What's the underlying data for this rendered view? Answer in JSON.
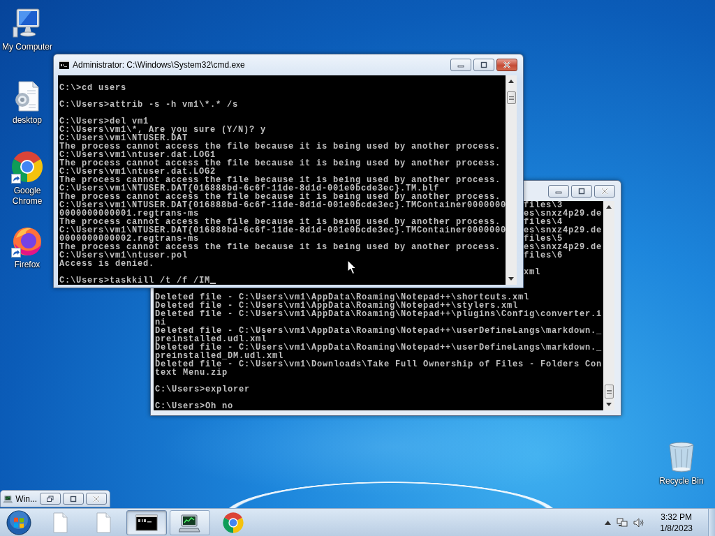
{
  "desktop_icons": [
    {
      "label": "My Computer",
      "kind": "computer",
      "shortcut": false
    },
    {
      "label": "desktop",
      "kind": "settings-file",
      "shortcut": false
    },
    {
      "label": "Google Chrome",
      "kind": "chrome",
      "shortcut": true
    },
    {
      "label": "Firefox",
      "kind": "firefox",
      "shortcut": true
    },
    {
      "label": "Recycle Bin",
      "kind": "recycle-bin",
      "shortcut": false
    }
  ],
  "windows": [
    {
      "active": false,
      "cursor": false,
      "fragment_blocks": [
        [
          "files\\3",
          "es\\snxz4p29.de",
          "files\\4",
          "es\\snxz4p29.de",
          "files\\5",
          "es\\snxz4p29.de",
          "files\\6"
        ],
        [
          "xml"
        ]
      ],
      "blocks": [
        [
          "Deleted file - C:\\Users\\vm1\\AppData\\Roaming\\Notepad++\\shortcuts.xml",
          "Deleted file - C:\\Users\\vm1\\AppData\\Roaming\\Notepad++\\stylers.xml",
          "Deleted file - C:\\Users\\vm1\\AppData\\Roaming\\Notepad++\\plugins\\Config\\converter.i",
          "ni",
          "Deleted file - C:\\Users\\vm1\\AppData\\Roaming\\Notepad++\\userDefineLangs\\markdown._",
          "preinstalled.udl.xml",
          "Deleted file - C:\\Users\\vm1\\AppData\\Roaming\\Notepad++\\userDefineLangs\\markdown._",
          "preinstalled_DM.udl.xml",
          "Deleted file - C:\\Users\\vm1\\Downloads\\Take Full Ownership of Files - Folders Con",
          "text Menu.zip"
        ],
        [
          "C:\\Users>explorer"
        ],
        [
          "C:\\Users>Oh no"
        ]
      ]
    },
    {
      "active": true,
      "cursor": true,
      "title": "Administrator: C:\\Windows\\System32\\cmd.exe",
      "blocks": [
        [
          "C:\\>cd users"
        ],
        [
          "C:\\Users>attrib -s -h vm1\\*.* /s"
        ],
        [
          "C:\\Users>del vm1",
          "C:\\Users\\vm1\\*, Are you sure (Y/N)? y",
          "C:\\Users\\vm1\\NTUSER.DAT",
          "The process cannot access the file because it is being used by another process.",
          "C:\\Users\\vm1\\ntuser.dat.LOG1",
          "The process cannot access the file because it is being used by another process.",
          "C:\\Users\\vm1\\ntuser.dat.LOG2",
          "The process cannot access the file because it is being used by another process.",
          "C:\\Users\\vm1\\NTUSER.DAT{016888bd-6c6f-11de-8d1d-001e0bcde3ec}.TM.blf",
          "The process cannot access the file because it is being used by another process.",
          "C:\\Users\\vm1\\NTUSER.DAT{016888bd-6c6f-11de-8d1d-001e0bcde3ec}.TMContainer0000000",
          "0000000000001.regtrans-ms",
          "The process cannot access the file because it is being used by another process.",
          "C:\\Users\\vm1\\NTUSER.DAT{016888bd-6c6f-11de-8d1d-001e0bcde3ec}.TMContainer0000000",
          "0000000000002.regtrans-ms",
          "The process cannot access the file because it is being used by another process.",
          "C:\\Users\\vm1\\ntuser.pol",
          "Access is denied."
        ],
        [
          "C:\\Users>taskkill /t /f /IM"
        ]
      ]
    }
  ],
  "minimized_window": {
    "title": "Win..."
  },
  "taskbar": {
    "items": [
      {
        "kind": "file",
        "running": false,
        "active": false
      },
      {
        "kind": "file",
        "running": false,
        "active": false
      },
      {
        "kind": "console",
        "running": true,
        "active": true
      },
      {
        "kind": "monitor",
        "running": true,
        "active": false
      },
      {
        "kind": "chrome",
        "running": false,
        "active": false
      }
    ],
    "clock": {
      "time": "3:32 PM",
      "date": "1/8/2023"
    }
  }
}
